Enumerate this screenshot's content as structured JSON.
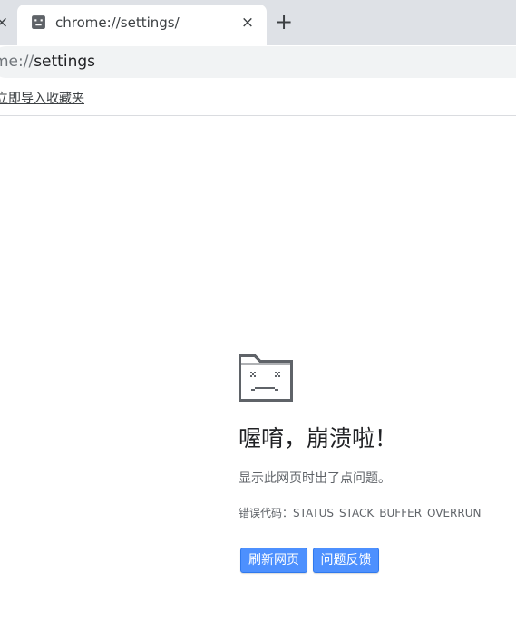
{
  "tabs": {
    "active_title": "chrome://settings/",
    "close_glyph": "×",
    "new_tab_glyph": "+"
  },
  "omnibox": {
    "scheme": "chrome://",
    "host": "settings"
  },
  "bookmarks_bar": {
    "import_link": "立即导入收藏夹"
  },
  "crash_page": {
    "title": "喔唷，崩溃啦！",
    "message": "显示此网页时出了点问题。",
    "error_code": "错误代码：STATUS_STACK_BUFFER_OVERRUN",
    "reload_button": "刷新网页",
    "feedback_button": "问题反馈"
  },
  "colors": {
    "tabstrip": "#dee1e6",
    "button_blue": "#4d90fe",
    "text_secondary": "#5f6368"
  },
  "icons": [
    "sad-tab-icon",
    "close-icon",
    "plus-icon"
  ]
}
